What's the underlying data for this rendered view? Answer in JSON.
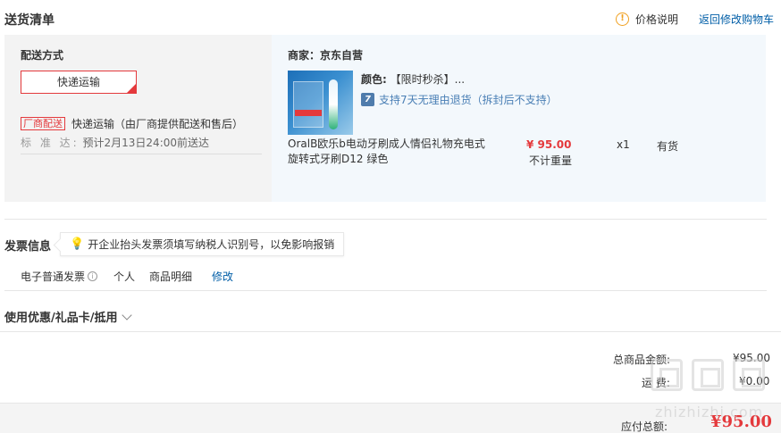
{
  "header": {
    "title": "送货清单",
    "price_note": "价格说明",
    "back_link": "返回修改购物车"
  },
  "delivery": {
    "label": "配送方式",
    "button": "快递运输",
    "factory_badge": "厂商配送",
    "factory_text": "快递运输（由厂商提供配送和售后）",
    "standard_label": "标 准 达:",
    "standard_text": "预计2月13日24:00前送达"
  },
  "goods": {
    "merchant": "商家：京东自营",
    "color_label": "颜色:",
    "color_value": "【限时秒杀】...",
    "return_icon": "7",
    "return_text": "支持7天无理由退货（拆封后不支持）",
    "product_name": "OralB欧乐b电动牙刷成人情侣礼物充电式旋转式牙刷D12 绿色",
    "price": "¥ 95.00",
    "weight": "不计重量",
    "quantity": "x1",
    "stock": "有货"
  },
  "invoice": {
    "title": "发票信息",
    "tip": "开企业抬头发票须填写纳税人识别号，以免影响报销",
    "type": "电子普通发票",
    "personal": "个人",
    "detail": "商品明细",
    "modify": "修改"
  },
  "coupon": {
    "label": "使用优惠/礼品卡/抵用"
  },
  "totals": {
    "goods_label": "总商品金额:",
    "goods_value": "¥95.00",
    "shipping_label": "运 费:",
    "shipping_value": "¥0.00",
    "pay_label": "应付总额:",
    "pay_value": "¥95.00"
  },
  "watermark": {
    "text": "zhizhizhi.com"
  },
  "colors": {
    "accent": "#e4393c",
    "link": "#005ea7",
    "goods_bg": "#f3f8fc",
    "delivery_bg": "#f3f3f3"
  }
}
